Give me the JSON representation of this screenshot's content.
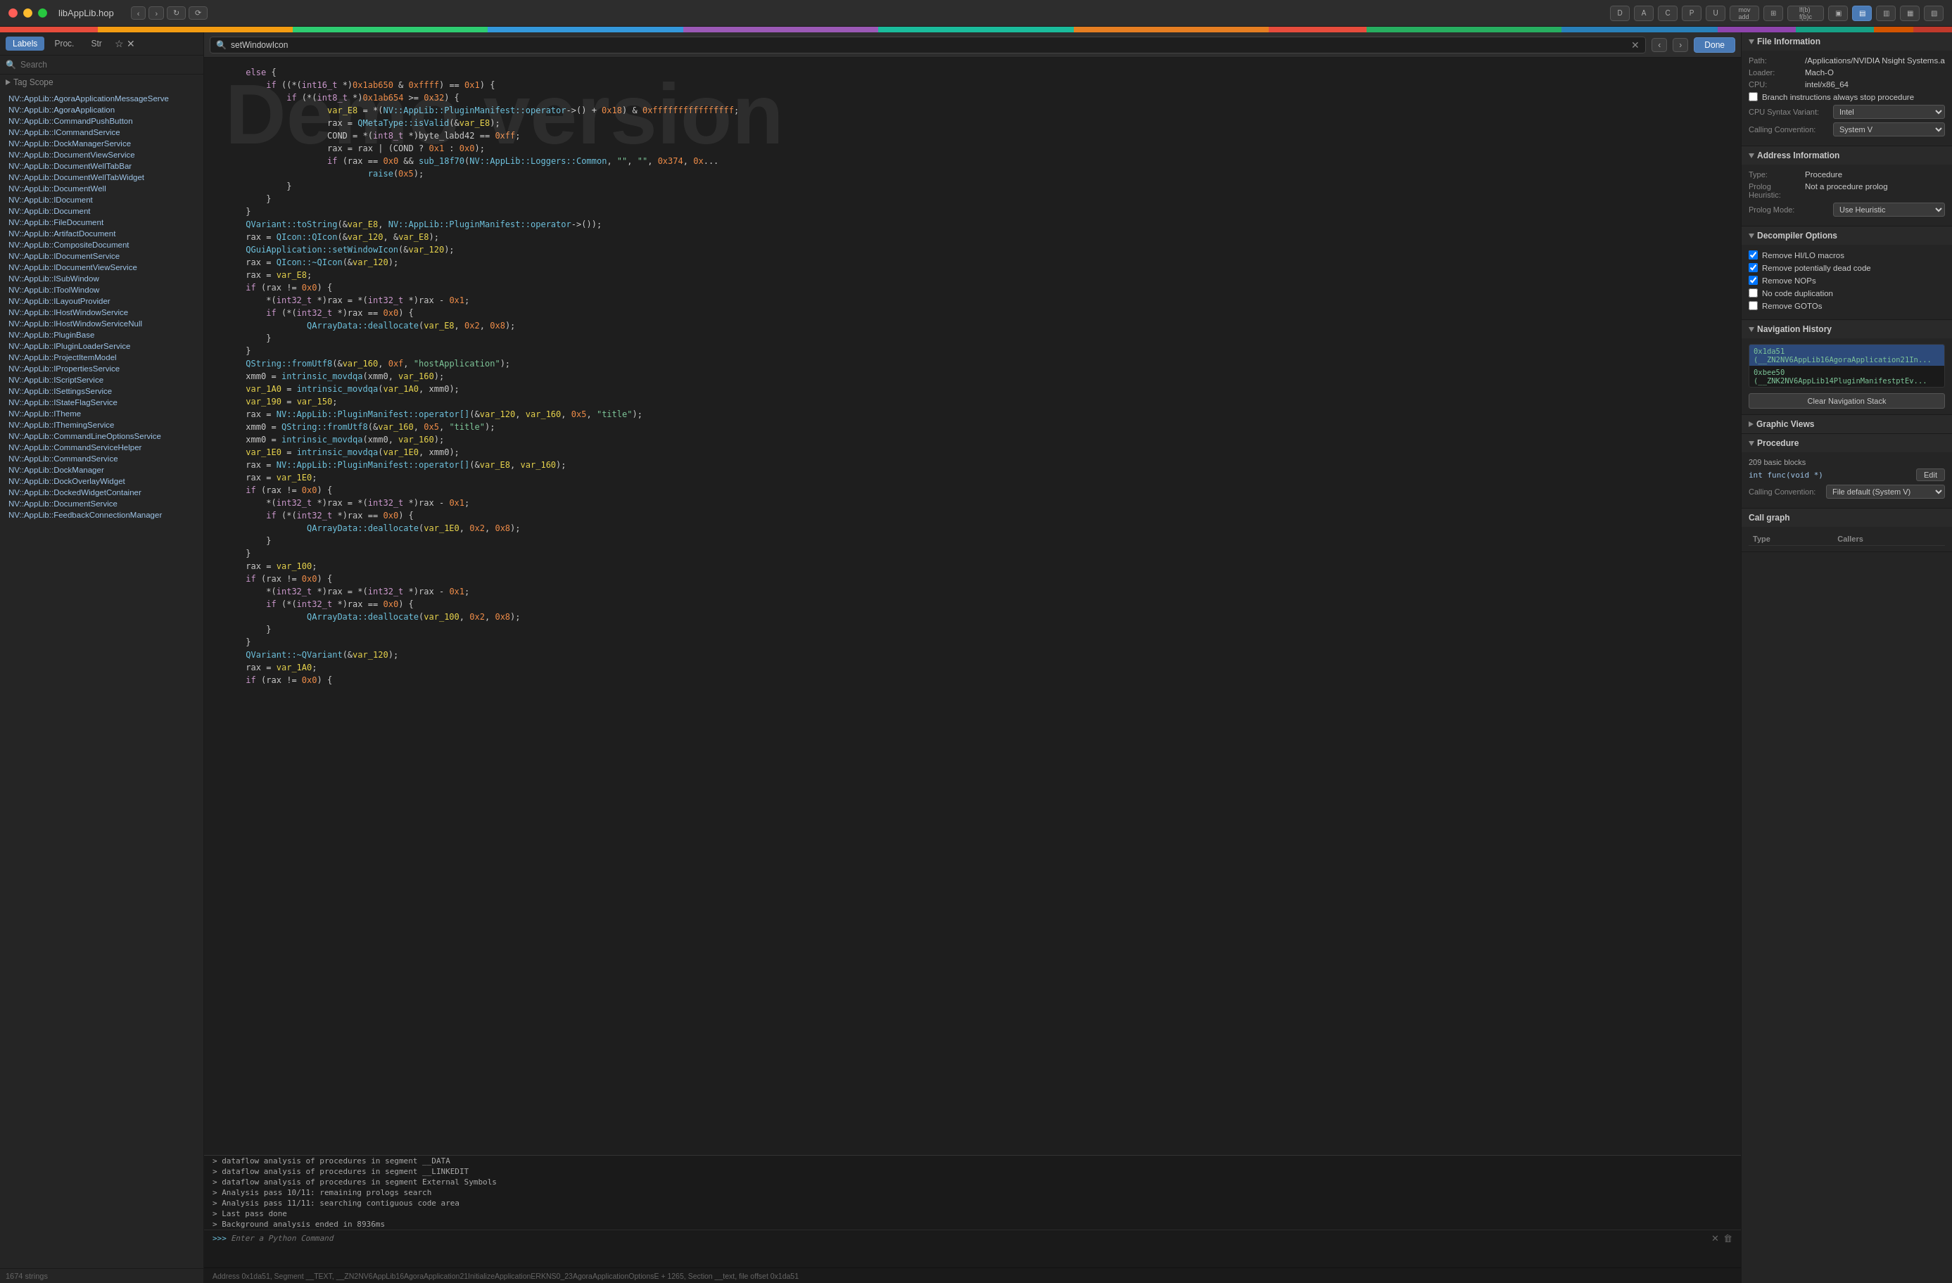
{
  "titlebar": {
    "title": "libAppLib.hop",
    "nav_back_label": "‹",
    "nav_forward_label": "›",
    "refresh_label": "↻",
    "reload_label": "⟳"
  },
  "toolbar": {
    "buttons": [
      "D",
      "A",
      "C",
      "P",
      "U",
      "mov add",
      "⊞",
      "lf(b) f(b)c",
      "⊟⊠",
      "⊡",
      "⊢"
    ]
  },
  "search_bar": {
    "placeholder": "setWindowIcon",
    "value": "setWindowIcon",
    "done_label": "Done"
  },
  "sidebar": {
    "tabs": [
      "Labels",
      "Proc.",
      "Str"
    ],
    "search_placeholder": "Search",
    "tag_scope_label": "Tag Scope",
    "items": [
      "NV::AppLib::AgoraApplicationMessageServe",
      "NV::AppLib::AgoraApplication",
      "NV::AppLib::CommandPushButton",
      "NV::AppLib::ICommandService",
      "NV::AppLib::DockManagerService",
      "NV::AppLib::DocumentViewService",
      "NV::AppLib::DocumentWellTabBar",
      "NV::AppLib::DocumentWellTabWidget",
      "NV::AppLib::DocumentWell",
      "NV::AppLib::IDocument",
      "NV::AppLib::Document",
      "NV::AppLib::FileDocument",
      "NV::AppLib::ArtifactDocument",
      "NV::AppLib::CompositeDocument",
      "NV::AppLib::IDocumentService",
      "NV::AppLib::IDocumentViewService",
      "NV::AppLib::ISubWindow",
      "NV::AppLib::IToolWindow",
      "NV::AppLib::ILayoutProvider",
      "NV::AppLib::IHostWindowService",
      "NV::AppLib::IHostWindowServiceNull",
      "NV::AppLib::PluginBase",
      "NV::AppLib::IPluginLoaderService",
      "NV::AppLib::ProjectItemModel",
      "NV::AppLib::IPropertiesService",
      "NV::AppLib::IScriptService",
      "NV::AppLib::ISettingsService",
      "NV::AppLib::IStateFlagService",
      "NV::AppLib::ITheme",
      "NV::AppLib::IThemingService",
      "NV::AppLib::CommandLineOptionsService",
      "NV::AppLib::CommandServiceHelper",
      "NV::AppLib::CommandService",
      "NV::AppLib::DockManager",
      "NV::AppLib::DockOverlayWidget",
      "NV::AppLib::DockedWidgetContainer",
      "NV::AppLib::DocumentService",
      "NV::AppLib::FeedbackConnectionManager"
    ],
    "count": "1674 strings"
  },
  "code": {
    "demo_overlay": "Demo version",
    "content": "      else {\n          if ((*(int16_t *)0x1ab650 & 0xffff) == 0x1) {\n              if (*(int8_t *)0x1ab654 >= 0x32) {\n                      var_E8 = *(NV::AppLib::PluginManifest::operator->() + 0x18) & 0xffffffffffffffff;\n                      rax = QMetaType::isValid(&var_E8);\n                      COND = *(int8_t *)byte_labd42 == 0xff;\n                      rax = rax | (COND ? 0x1 : 0x0);\n                      if (rax == 0x0 && sub_18f70(NV::AppLib::Loggers::Common, \"\", \"\", 0x374, 0x...\n                              raise(0x5);\n              }\n          }\n      }\n      QVariant::toString(&var_E8, NV::AppLib::PluginManifest::operator->());\n      rax = QIcon::QIcon(&var_120, &var_E8);\n      QGuiApplication::setWindowIcon(&var_120);\n      rax = QIcon::~QIcon(&var_120);\n      rax = var_E8;\n      if (rax != 0x0) {\n          *(int32_t *)rax = *(int32_t *)rax - 0x1;\n          if (*(int32_t *)rax == 0x0) {\n                  QArrayData::deallocate(var_E8, 0x2, 0x8);\n          }\n      }\n      QString::fromUtf8(&var_160, 0xf, \"hostApplication\");\n      xmm0 = intrinsic_movdqa(xmm0, var_160);\n      var_1A0 = intrinsic_movdqa(var_1A0, xmm0);\n      var_190 = var_150;\n      rax = NV::AppLib::PluginManifest::operator[](&var_120, var_160, 0x5, \"title\");\n      xmm0 = QString::fromUtf8(&var_160, 0x5, \"title\");\n      xmm0 = intrinsic_movdqa(xmm0, var_160);\n      var_1E0 = intrinsic_movdqa(var_1E0, xmm0);\n      rax = NV::AppLib::PluginManifest::operator[](&var_E8, var_160);\n      rax = var_1E0;\n      if (rax != 0x0) {\n          *(int32_t *)rax = *(int32_t *)rax - 0x1;\n          if (*(int32_t *)rax == 0x0) {\n                  QArrayData::deallocate(var_1E0, 0x2, 0x8);\n          }\n      }\n      rax = var_100;\n      if (rax != 0x0) {\n          *(int32_t *)rax = *(int32_t *)rax - 0x1;\n          if (*(int32_t *)rax == 0x0) {\n                  QArrayData::deallocate(var_100, 0x2, 0x8);\n          }\n      }\n      QVariant::~QVariant(&var_120);\n      rax = var_1A0;\n      if (rax != 0x0) {"
  },
  "console": {
    "lines": [
      "> dataflow analysis of procedures in segment __DATA",
      "> dataflow analysis of procedures in segment __LINKEDIT",
      "> dataflow analysis of procedures in segment External Symbols",
      "> Analysis pass 10/11: remaining prologs search",
      "> Analysis pass 11/11: searching contiguous code area",
      "> Last pass done",
      "Background analysis ended in 8936ms"
    ],
    "input_placeholder": "Enter a Python Command"
  },
  "statusbar": {
    "text": "Address 0x1da51, Segment __TEXT, __ZN2NV6AppLib16AgoraApplication21InitializeApplicationERKNS0_23AgoraApplicationOptionsE + 1265, Section __text, file offset 0x1da51"
  },
  "right_panel": {
    "file_info": {
      "title": "File Information",
      "path_label": "Path:",
      "path_value": "/Applications/NVIDIA Nsight Systems.a",
      "loader_label": "Loader:",
      "loader_value": "Mach-O",
      "cpu_label": "CPU:",
      "cpu_value": "intel/x86_64",
      "branch_checkbox": "Branch instructions always stop procedure",
      "branch_checked": false,
      "cpu_syntax_label": "CPU Syntax Variant:",
      "cpu_syntax_value": "Intel",
      "calling_conv_label": "Calling Convention:",
      "calling_conv_value": "System V"
    },
    "address_info": {
      "title": "Address Information",
      "type_label": "Type:",
      "type_value": "Procedure",
      "prolog_heuristic_label": "Prolog Heuristic:",
      "prolog_heuristic_value": "Not a procedure prolog",
      "prolog_mode_label": "Prolog Mode:",
      "prolog_mode_value": "Use Heuristic"
    },
    "decompiler": {
      "title": "Decompiler Options",
      "options": [
        {
          "label": "Remove HI/LO macros",
          "checked": true
        },
        {
          "label": "Remove potentially dead code",
          "checked": true
        },
        {
          "label": "Remove NOPs",
          "checked": true
        },
        {
          "label": "No code duplication",
          "checked": false
        },
        {
          "label": "Remove GOTOs",
          "checked": false
        }
      ]
    },
    "navigation_history": {
      "title": "Navigation History",
      "items": [
        "0x1da51 (__ZN2NV6AppLib16AgoraApplication21In...",
        "0xbee50 (__ZNK2NV6AppLib14PluginManifestptEv..."
      ],
      "clear_btn_label": "Clear Navigation Stack"
    },
    "graphic_views": {
      "title": "Graphic Views"
    },
    "procedure": {
      "title": "Procedure",
      "blocks": "209 basic blocks",
      "signature": "int func(void *)",
      "edit_btn": "Edit",
      "calling_conv_label": "Calling Convention:",
      "calling_conv_value": "File default (System V)"
    },
    "call_graph": {
      "title": "Call graph",
      "col_type": "Type",
      "col_callers": "Callers"
    }
  }
}
